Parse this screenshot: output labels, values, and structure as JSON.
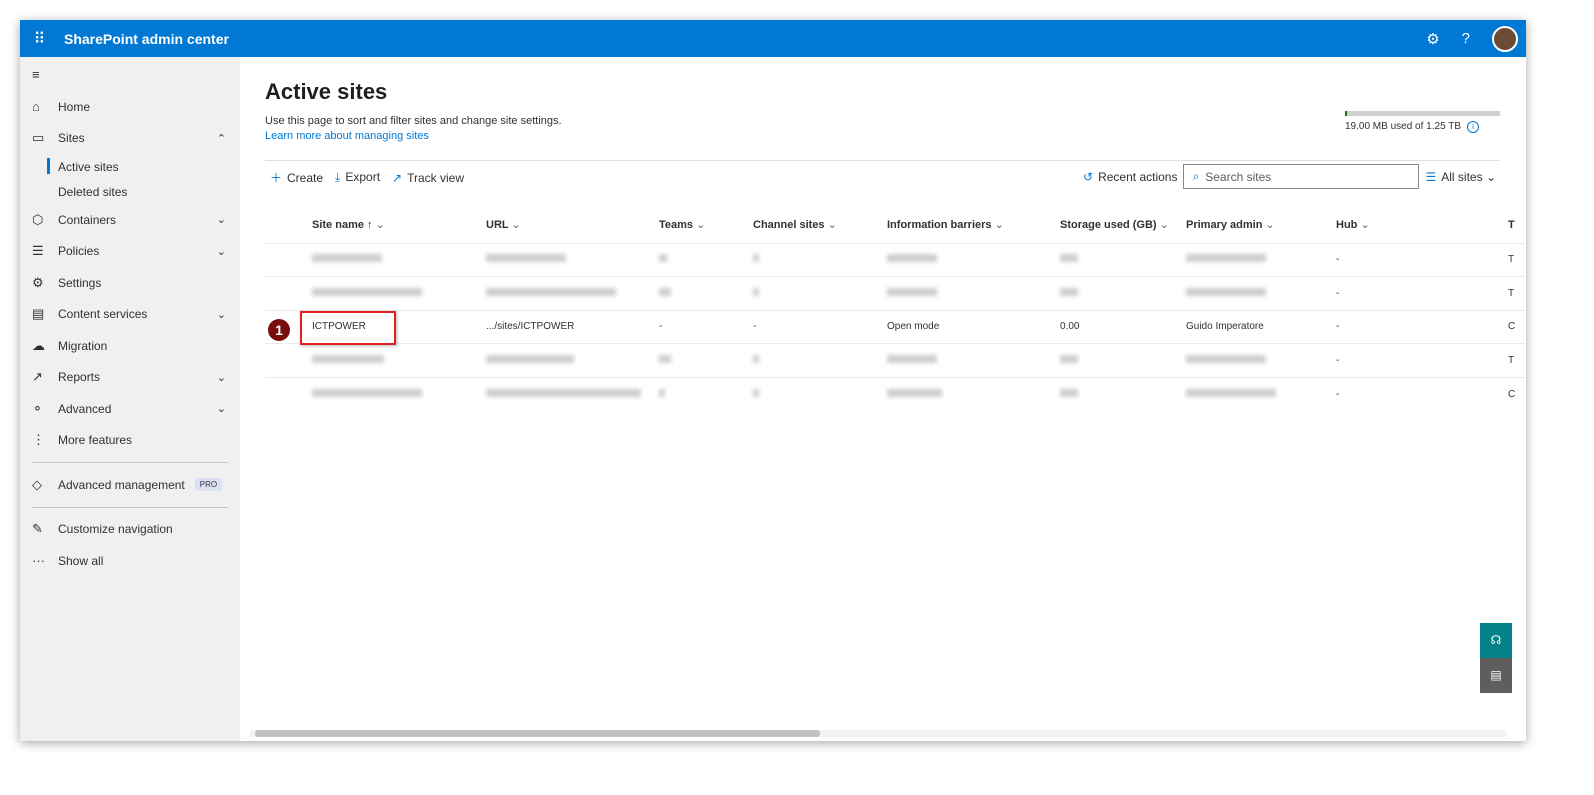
{
  "header": {
    "app_title": "SharePoint admin center",
    "settings_icon": "gear-icon",
    "help_label": "?"
  },
  "sidebar": {
    "items": [
      {
        "label": "Home",
        "icon": "⌂"
      },
      {
        "label": "Sites",
        "icon": "▭",
        "chev": "⌃"
      },
      {
        "label": "Active sites"
      },
      {
        "label": "Deleted sites"
      },
      {
        "label": "Containers",
        "icon": "⬡",
        "chev": "⌄"
      },
      {
        "label": "Policies",
        "icon": "☰",
        "chev": "⌄"
      },
      {
        "label": "Settings",
        "icon": "⚙"
      },
      {
        "label": "Content services",
        "icon": "▤",
        "chev": "⌄"
      },
      {
        "label": "Migration",
        "icon": "☁"
      },
      {
        "label": "Reports",
        "icon": "↗",
        "chev": "⌄"
      },
      {
        "label": "Advanced",
        "icon": "⚬",
        "chev": "⌄"
      },
      {
        "label": "More features",
        "icon": "⋮"
      },
      {
        "label": "Advanced management",
        "icon": "◇",
        "badge": "PRO"
      },
      {
        "label": "Customize navigation",
        "icon": "✎"
      },
      {
        "label": "Show all",
        "icon": "···"
      }
    ]
  },
  "page": {
    "title": "Active sites",
    "description": "Use this page to sort and filter sites and change site settings.",
    "learn_more": "Learn more about managing sites",
    "storage": {
      "text": "19.00 MB used of 1.25 TB",
      "fraction": 0.015
    }
  },
  "toolbar": {
    "create": "Create",
    "export": "Export",
    "track_view": "Track view",
    "recent_actions": "Recent actions",
    "search_placeholder": "Search sites",
    "view": "All sites"
  },
  "table": {
    "columns": [
      "Site name ↑",
      "URL",
      "Teams",
      "Channel sites",
      "Information barriers",
      "Storage used (GB)",
      "Primary admin",
      "Hub",
      "T"
    ],
    "highlight_row": {
      "site_name": "ICTPOWER",
      "url": ".../sites/ICTPOWER",
      "teams": "-",
      "channel_sites": "-",
      "info_barriers": "Open mode",
      "storage": "0.00",
      "primary_admin": "Guido  Imperatore",
      "hub": "-",
      "last": "C"
    },
    "other_rows_hub": [
      "-",
      "-",
      "-",
      "-"
    ],
    "other_rows_last": [
      "T",
      "T",
      "T",
      "C"
    ]
  },
  "annotation": {
    "number": "1"
  }
}
